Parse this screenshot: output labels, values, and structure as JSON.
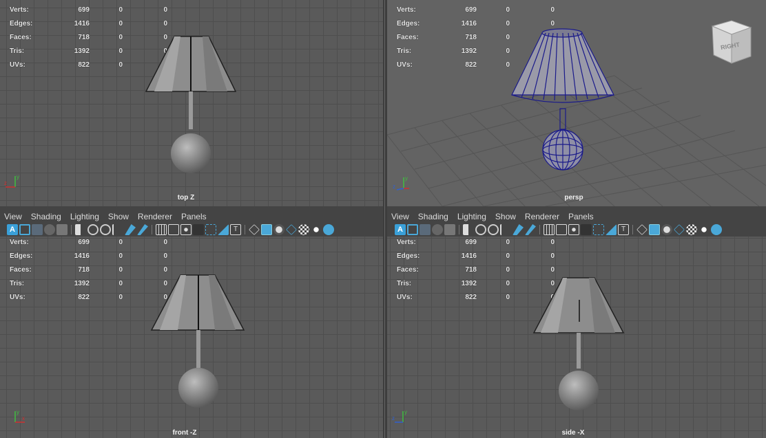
{
  "hud": {
    "rows": [
      {
        "label": "Verts:",
        "value": "699",
        "sel": "0",
        "sel2": "0"
      },
      {
        "label": "Edges:",
        "value": "1416",
        "sel": "0",
        "sel2": "0"
      },
      {
        "label": "Faces:",
        "value": "718",
        "sel": "0",
        "sel2": "0"
      },
      {
        "label": "Tris:",
        "value": "1392",
        "sel": "0",
        "sel2": "0"
      },
      {
        "label": "UVs:",
        "value": "822",
        "sel": "0",
        "sel2": "0"
      }
    ]
  },
  "viewports": {
    "top": {
      "name": "top Z"
    },
    "persp": {
      "name": "persp",
      "viewcube": "RIGHT"
    },
    "front": {
      "name": "front -Z"
    },
    "side": {
      "name": "side -X"
    }
  },
  "menu": [
    "View",
    "Shading",
    "Lighting",
    "Show",
    "Renderer",
    "Panels"
  ],
  "colors": {
    "wireframe": "#1a1a8a",
    "accent": "#3aa0d8",
    "grid": "#4e4e4e"
  },
  "icons": [
    "select-camera-icon",
    "camera-attributes-icon",
    "bookmark-icon",
    "image-plane-icon",
    "2d-pan-icon",
    "grease-pencil-icon",
    "grid-icon",
    "film-gate-icon",
    "resolution-gate-icon",
    "gate-mask-icon",
    "field-chart-icon",
    "safe-action-icon",
    "safe-title-icon",
    "wireframe-icon",
    "smooth-shade-icon",
    "wireframe-on-shaded-icon",
    "xray-icon",
    "xray-joints-icon",
    "use-all-lights-icon",
    "shadows-icon",
    "isolate-select-icon"
  ]
}
